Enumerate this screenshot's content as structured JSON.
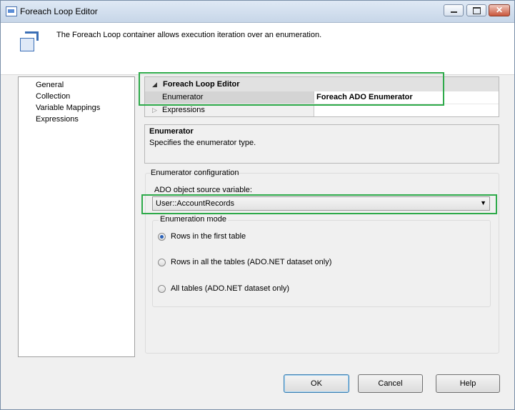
{
  "window": {
    "title": "Foreach Loop Editor"
  },
  "header": {
    "description": "The Foreach Loop container allows execution iteration over an enumeration."
  },
  "nav": {
    "items": [
      "General",
      "Collection",
      "Variable Mappings",
      "Expressions"
    ]
  },
  "grid": {
    "category": "Foreach Loop Editor",
    "rows": [
      {
        "label": "Enumerator",
        "value": "Foreach ADO Enumerator"
      },
      {
        "label": "Expressions",
        "value": ""
      }
    ]
  },
  "description_panel": {
    "title": "Enumerator",
    "text": "Specifies the enumerator type."
  },
  "config": {
    "group_label": "Enumerator configuration",
    "ado_label": "ADO object source variable:",
    "ado_value": "User::AccountRecords",
    "mode_label": "Enumeration mode",
    "modes": [
      {
        "label": "Rows in the first table",
        "selected": true
      },
      {
        "label": "Rows in all the tables (ADO.NET dataset only)",
        "selected": false
      },
      {
        "label": "All tables (ADO.NET dataset only)",
        "selected": false
      }
    ]
  },
  "buttons": {
    "ok": "OK",
    "cancel": "Cancel",
    "help": "Help"
  },
  "colors": {
    "highlight": "#2eaa4a",
    "radio_selected": "#2a61b8"
  },
  "icons": {
    "title": "foreach-loop-icon",
    "header": "foreach-container-icon",
    "expand": "triangle-icon",
    "dropdown": "chevron-down-icon"
  }
}
